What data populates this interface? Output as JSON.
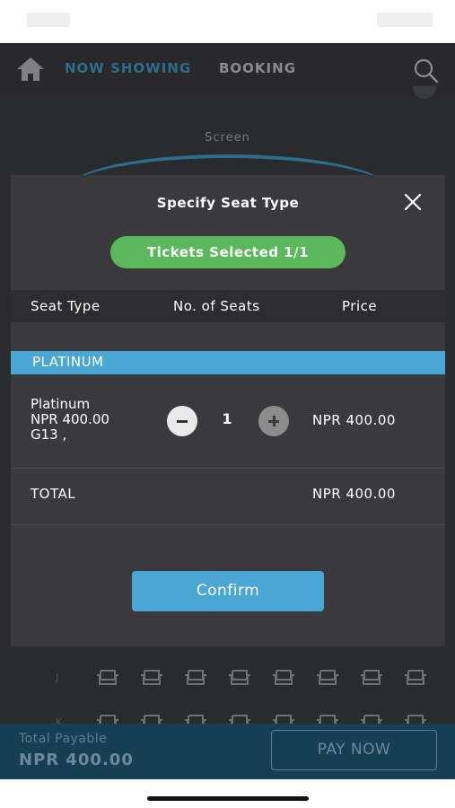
{
  "header": {
    "nav_now_showing": "NOW SHOWING",
    "nav_booking": "BOOKING",
    "home_icon": "home-icon",
    "search_icon": "search-icon"
  },
  "background": {
    "screen_label": "Screen",
    "row_letters": [
      "J",
      "K"
    ],
    "seat_icon": "seat-icon"
  },
  "modal": {
    "title": "Specify Seat Type",
    "close_icon": "close-icon",
    "tickets_selected": "Tickets Selected 1/1",
    "columns": [
      "Seat Type",
      "No. of Seats",
      "Price"
    ],
    "section": "PLATINUM",
    "seat_row": {
      "type": "Platinum",
      "unit_price": "NPR 400.00",
      "seats": "G13 ,",
      "quantity": "1",
      "price": "NPR 400.00"
    },
    "total_label": "TOTAL",
    "total_value": "NPR 400.00",
    "confirm_label": "Confirm"
  },
  "footer": {
    "total_payable_label": "Total Payable",
    "total_payable_value": "NPR 400.00",
    "pay_now_label": "PAY NOW"
  },
  "colors": {
    "accent_blue": "#4aa7d4",
    "pill_green": "#5bb85c",
    "modal_bg": "#3a3a3c"
  }
}
